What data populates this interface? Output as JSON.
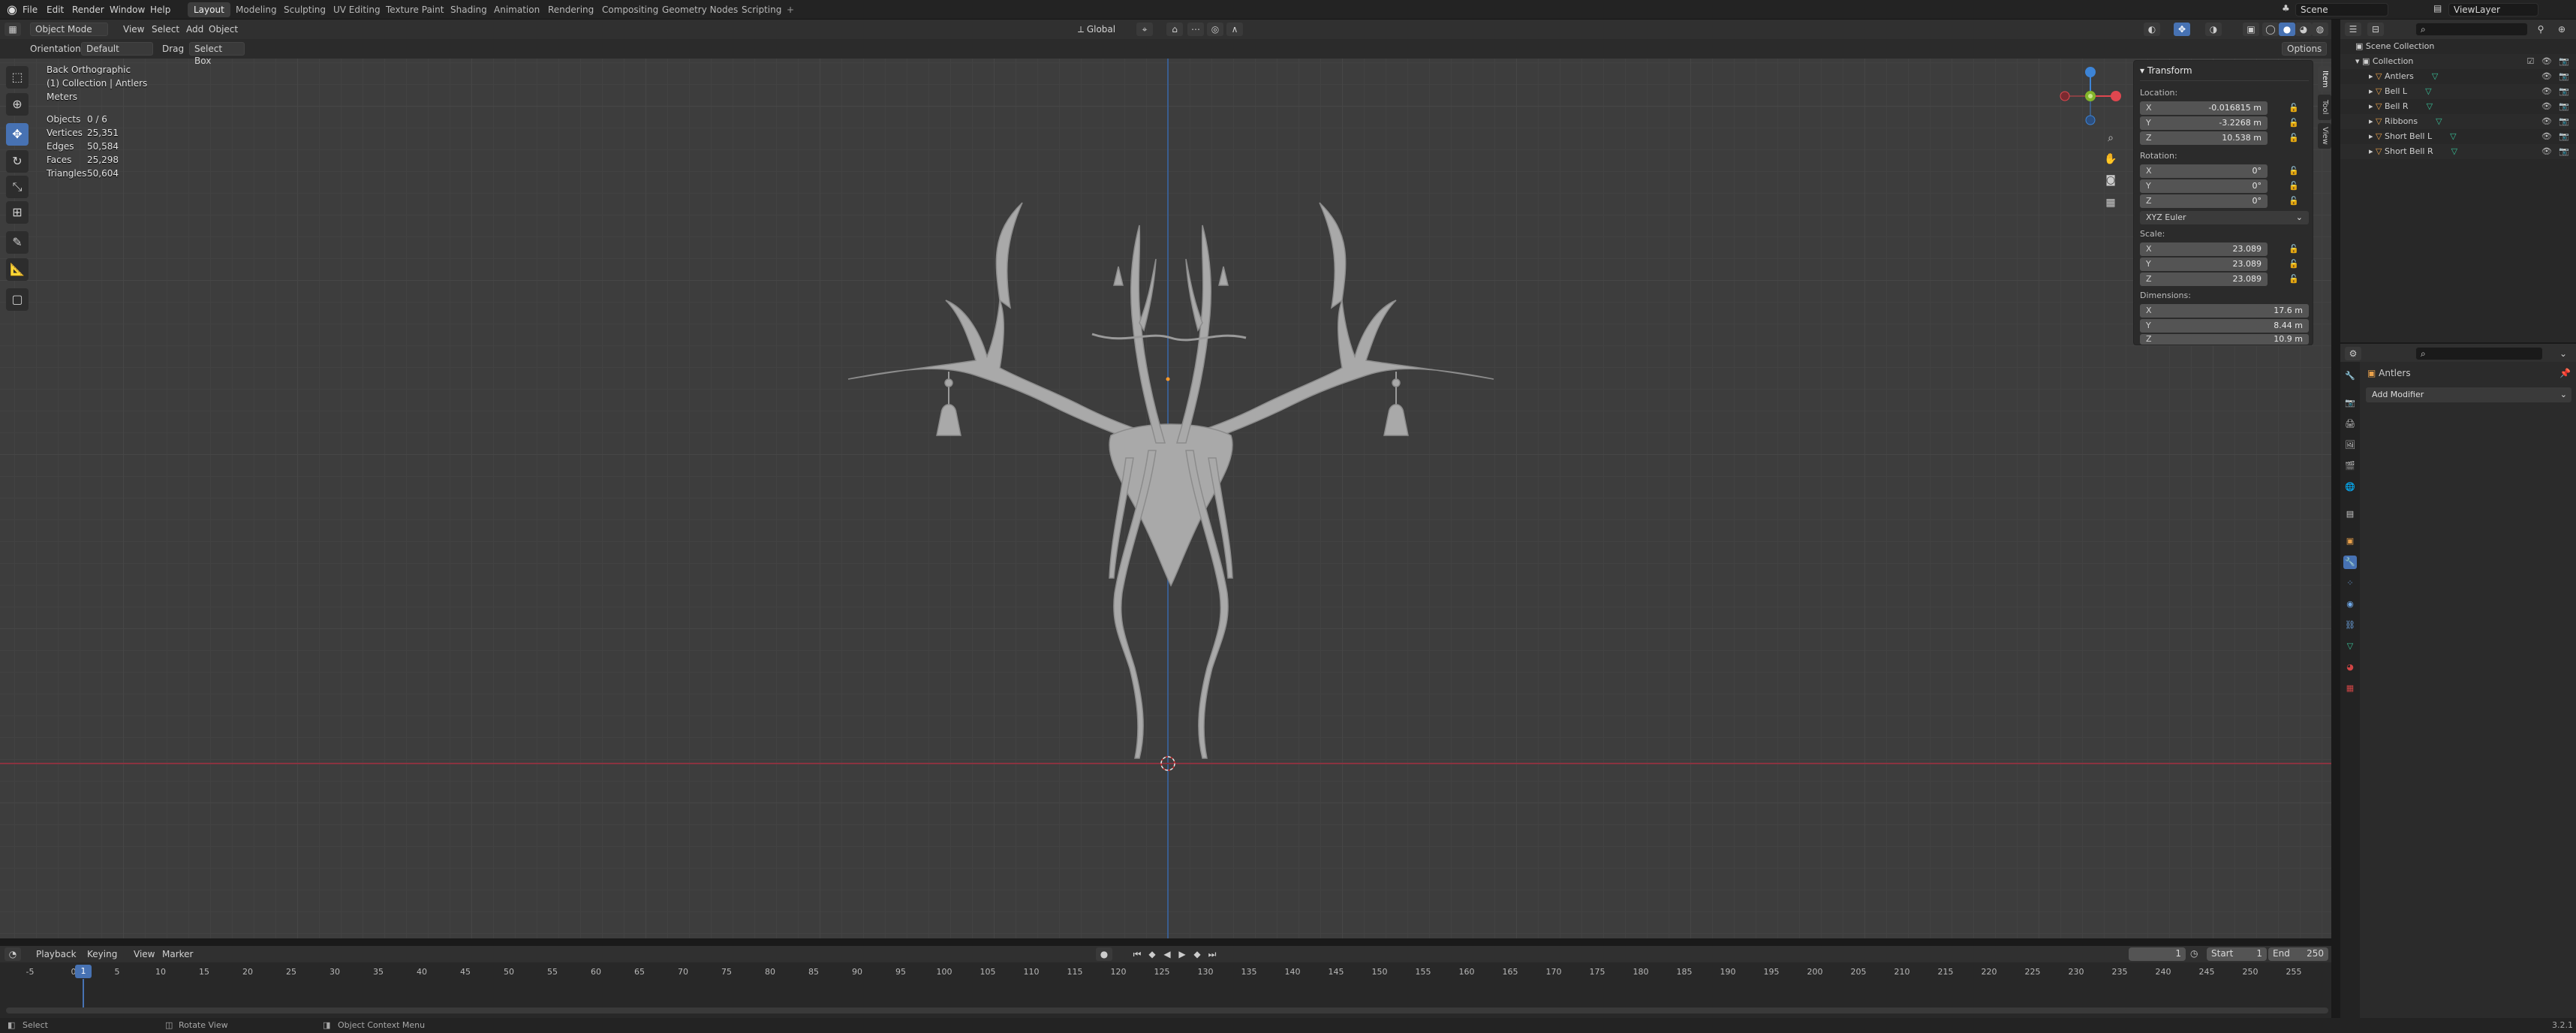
{
  "menubar": {
    "items": [
      "File",
      "Edit",
      "Render",
      "Window",
      "Help"
    ],
    "workspaces": [
      "Layout",
      "Modeling",
      "Sculpting",
      "UV Editing",
      "Texture Paint",
      "Shading",
      "Animation",
      "Rendering",
      "Compositing",
      "Geometry Nodes",
      "Scripting"
    ],
    "active_workspace": "Layout",
    "add_tab": "+",
    "scene": "Scene",
    "view_layer": "ViewLayer"
  },
  "viewport_header": {
    "mode": "Object Mode",
    "menus": [
      "View",
      "Select",
      "Add",
      "Object"
    ],
    "transform_orientation": "Global",
    "options": "Options"
  },
  "tool_settings": {
    "orientation_label": "Orientation:",
    "orientation_value": "Default",
    "drag_label": "Drag",
    "drag_value": "Select Box"
  },
  "overlay": {
    "view_name": "Back Orthographic",
    "collection_path": "(1) Collection | Antlers",
    "units": "Meters",
    "stats": [
      {
        "label": "Objects",
        "value": "0 / 6"
      },
      {
        "label": "Vertices",
        "value": "25,351"
      },
      {
        "label": "Edges",
        "value": "50,584"
      },
      {
        "label": "Faces",
        "value": "25,298"
      },
      {
        "label": "Triangles",
        "value": "50,604"
      }
    ]
  },
  "n_panel": {
    "title": "Transform",
    "location_label": "Location:",
    "location": {
      "x": "-0.016815 m",
      "y": "-3.2268 m",
      "z": "10.538 m"
    },
    "rotation_label": "Rotation:",
    "rotation": {
      "x": "0°",
      "y": "0°",
      "z": "0°"
    },
    "rotation_mode": "XYZ Euler",
    "scale_label": "Scale:",
    "scale": {
      "x": "23.089",
      "y": "23.089",
      "z": "23.089"
    },
    "dimensions_label": "Dimensions:",
    "dimensions": {
      "x": "17.6 m",
      "y": "8.44 m",
      "z": "10.9 m"
    },
    "axes": [
      "X",
      "Y",
      "Z"
    ],
    "tabs": [
      "Item",
      "Tool",
      "View"
    ]
  },
  "timeline": {
    "menus": [
      "Playback",
      "Keying",
      "View",
      "Marker"
    ],
    "current_frame": "1",
    "start_label": "Start",
    "start": "1",
    "end_label": "End",
    "end": "250",
    "ticks": [
      "-5",
      "0",
      "5",
      "10",
      "15",
      "20",
      "25",
      "30",
      "35",
      "40",
      "45",
      "50",
      "55",
      "60",
      "65",
      "70",
      "75",
      "80",
      "85",
      "90",
      "95",
      "100",
      "105",
      "110",
      "115",
      "120",
      "125",
      "130",
      "135",
      "140",
      "145",
      "150",
      "155",
      "160",
      "165",
      "170",
      "175",
      "180",
      "185",
      "190",
      "195",
      "200",
      "205",
      "210",
      "215",
      "220",
      "225",
      "230",
      "235",
      "240",
      "245",
      "250",
      "255"
    ],
    "cursor_label": "1"
  },
  "outliner": {
    "scene_collection": "Scene Collection",
    "collection": "Collection",
    "items": [
      "Antlers",
      "Bell L",
      "Bell R",
      "Ribbons",
      "Short Bell L",
      "Short Bell R"
    ]
  },
  "properties": {
    "object_name": "Antlers",
    "add_modifier": "Add Modifier"
  },
  "statusbar": {
    "select": "Select",
    "rotate_view": "Rotate View",
    "context_menu": "Object Context Menu",
    "version": "3.2.1"
  },
  "colors": {
    "accent": "#4772b3",
    "x_axis": "#e0474f",
    "y_axis": "#83b52a",
    "z_axis": "#3d84d6",
    "mesh": "#a8a8a8"
  }
}
